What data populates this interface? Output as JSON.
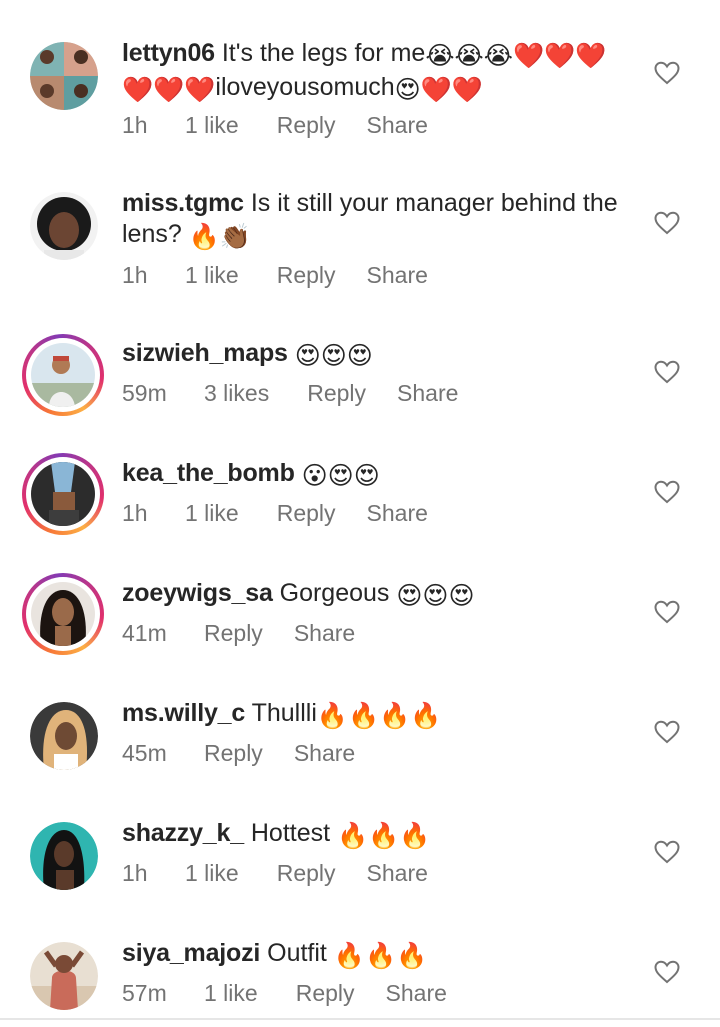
{
  "comments": [
    {
      "username": "lettyn06",
      "text": "It's the legs for me",
      "text_after": "iloveyousomuch",
      "emoji_1": "😭😭😭❤️❤️❤️",
      "emoji_2": "❤️❤️❤️",
      "emoji_3": "😍❤️❤️",
      "time": "1h",
      "likes": "1 like",
      "reply": "Reply",
      "share": "Share",
      "like_icon": "heart-outline-icon"
    },
    {
      "username": "miss.tgmc",
      "text": "Is it still your manager behind the lens?",
      "emoji": "🔥👏🏾",
      "time": "1h",
      "likes": "1 like",
      "reply": "Reply",
      "share": "Share",
      "like_icon": "heart-outline-icon"
    },
    {
      "username": "sizwieh_maps",
      "text": "",
      "emoji": "😍😍😍",
      "time": "59m",
      "likes": "3 likes",
      "reply": "Reply",
      "share": "Share",
      "like_icon": "heart-outline-icon"
    },
    {
      "username": "kea_the_bomb",
      "text": "",
      "emoji": "😮😍😍",
      "time": "1h",
      "likes": "1 like",
      "reply": "Reply",
      "share": "Share",
      "like_icon": "heart-outline-icon"
    },
    {
      "username": "zoeywigs_sa",
      "text": "Gorgeous",
      "emoji": "😍😍😍",
      "time": "41m",
      "likes": "",
      "reply": "Reply",
      "share": "Share",
      "like_icon": "heart-outline-icon"
    },
    {
      "username": "ms.willy_c",
      "text": "Thullli",
      "emoji": "🔥🔥🔥🔥",
      "time": "45m",
      "likes": "",
      "reply": "Reply",
      "share": "Share",
      "like_icon": "heart-outline-icon"
    },
    {
      "username": "shazzy_k_",
      "text": "Hottest",
      "emoji": "🔥🔥🔥",
      "time": "1h",
      "likes": "1 like",
      "reply": "Reply",
      "share": "Share",
      "like_icon": "heart-outline-icon"
    },
    {
      "username": "siya_majozi",
      "text": "Outfit",
      "emoji": "🔥🔥🔥",
      "time": "57m",
      "likes": "1 like",
      "reply": "Reply",
      "share": "Share",
      "like_icon": "heart-outline-icon"
    }
  ],
  "colors": {
    "text": "#262626",
    "meta": "#737373",
    "story_ring_start": "#f77737",
    "story_ring_end": "#c13584"
  }
}
